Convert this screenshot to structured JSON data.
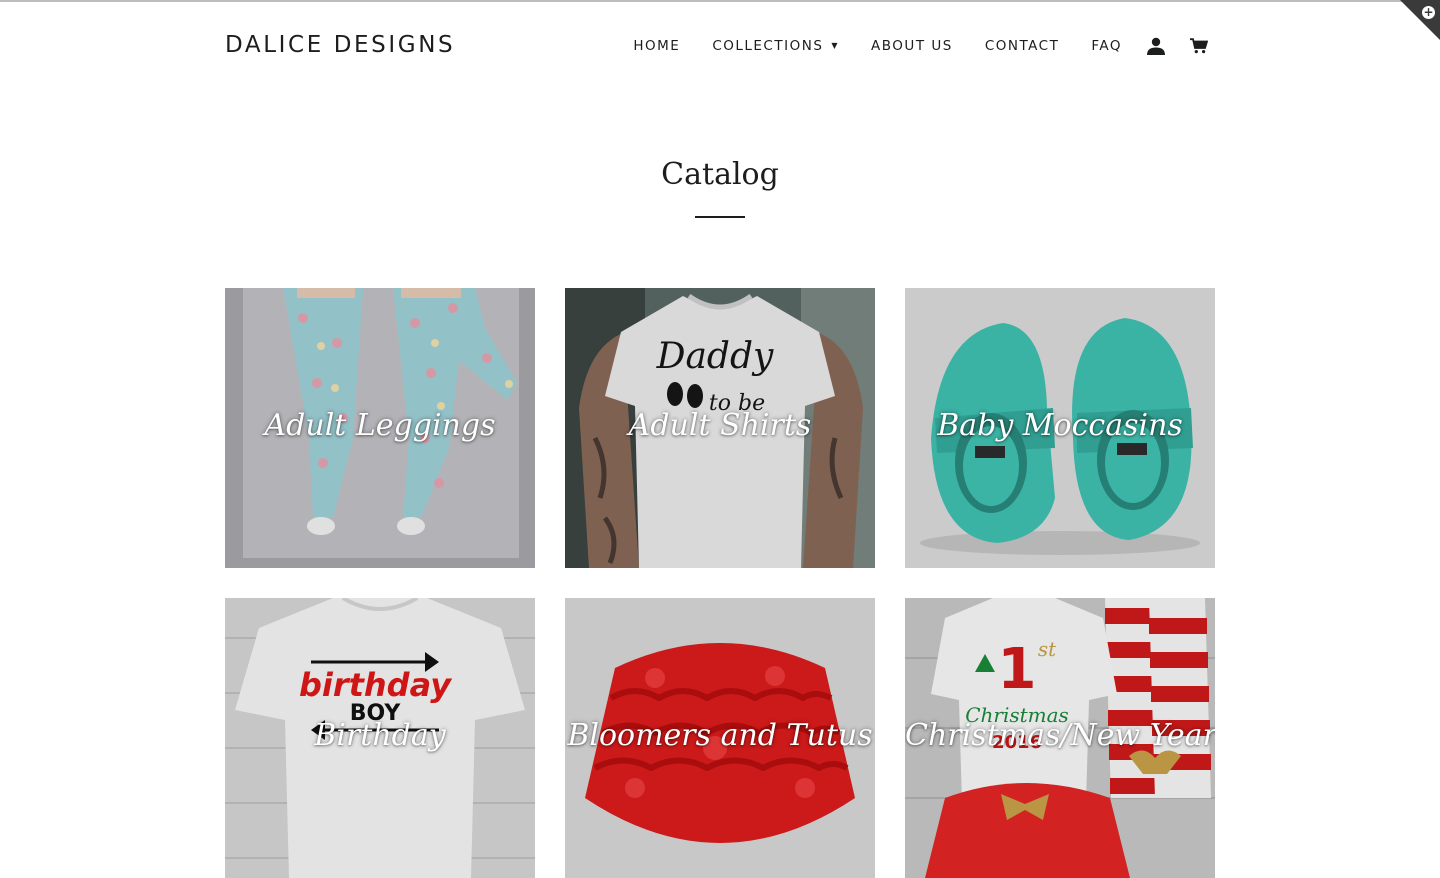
{
  "store": {
    "name": "DALICE DESIGNS"
  },
  "nav": {
    "items": [
      {
        "label": "HOME"
      },
      {
        "label": "COLLECTIONS",
        "has_dropdown": true
      },
      {
        "label": "ABOUT US"
      },
      {
        "label": "CONTACT"
      },
      {
        "label": "FAQ"
      }
    ],
    "icons": [
      "account-icon",
      "cart-icon"
    ]
  },
  "page": {
    "title": "Catalog"
  },
  "collections": [
    {
      "label": "Adult Leggings"
    },
    {
      "label": "Adult Shirts",
      "image_text": [
        "Daddy",
        "to be"
      ]
    },
    {
      "label": "Baby Moccasins"
    },
    {
      "label": "Birthday",
      "image_text": [
        "birthday",
        "BOY"
      ]
    },
    {
      "label": "Bloomers and Tutus"
    },
    {
      "label": "Christmas/New Years",
      "image_text": [
        "1",
        "st",
        "Christmas",
        "2016"
      ]
    }
  ],
  "colors": {
    "text": "#1c1d1d",
    "background": "#ffffff",
    "accent_dark": "#3a3a3a"
  }
}
